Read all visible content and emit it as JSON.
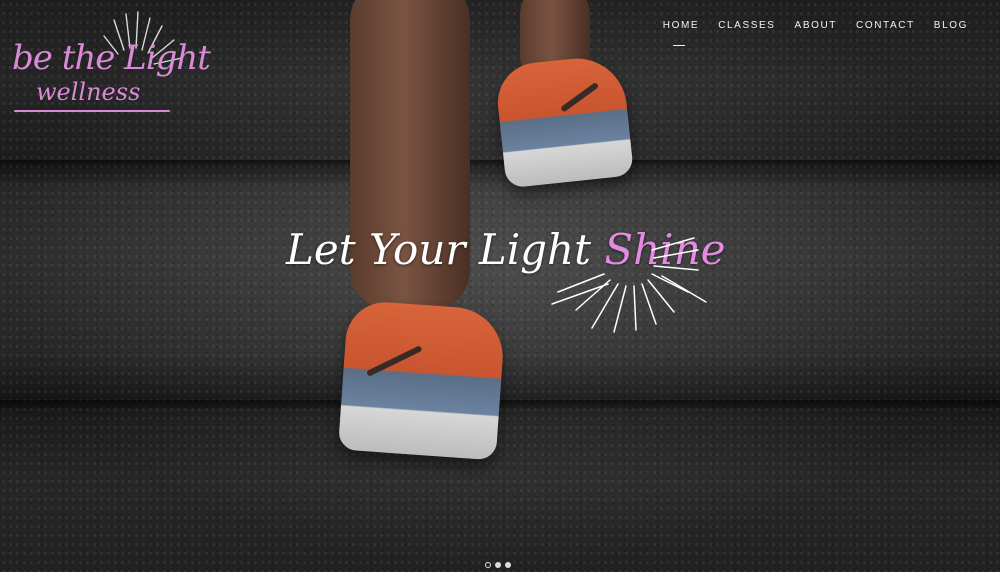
{
  "brand": {
    "logo_line1": "be the Light",
    "logo_line2": "wellness",
    "accent_color": "#d98ad6"
  },
  "nav": {
    "items": [
      {
        "label": "HOME",
        "active": true
      },
      {
        "label": "CLASSES",
        "active": false
      },
      {
        "label": "ABOUT",
        "active": false
      },
      {
        "label": "CONTACT",
        "active": false
      },
      {
        "label": "BLOG",
        "active": false
      }
    ]
  },
  "hero": {
    "headline_main": "Let Your Light ",
    "headline_accent": "Shine",
    "slider": {
      "count": 3,
      "active_index": 0
    }
  }
}
